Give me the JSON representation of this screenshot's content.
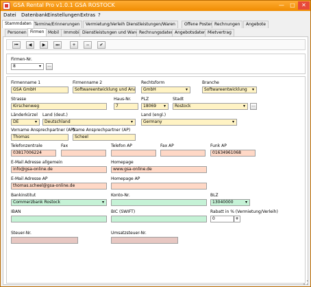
{
  "window": {
    "title": "GSA Rental Pro v1.0.1  GSA ROSTOCK",
    "min": "—",
    "max": "□",
    "close": "✕"
  },
  "menu": [
    "Datei",
    "Datenbank",
    "Einstellungen",
    "Extras",
    "?"
  ],
  "tabs_main": [
    "Stammdaten",
    "Termine/Erinnerungen",
    "Vermietung/Verleih Dienstleistungen/Waren",
    "Offene Posten",
    "Rechnungen",
    "Angebote"
  ],
  "tabs_sub": [
    "Personen",
    "Firmen",
    "Mobil",
    "Immobil",
    "Dienstleistungen und Waren",
    "Rechnungsdaten",
    "Angebotsdaten",
    "Mietvertrag"
  ],
  "toolbar": [
    "⏮",
    "◀",
    "▶",
    "⏭",
    "+",
    "−",
    "✔"
  ],
  "firmen_nr": {
    "label": "Firmen-Nr.",
    "value": "8"
  },
  "f": {
    "firmenname1": {
      "label": "Firmenname 1",
      "value": "GSA GmbH"
    },
    "firmenname2": {
      "label": "Firmenname 2",
      "value": "Softwareentwicklung und Analytik"
    },
    "rechtsform": {
      "label": "Rechtsform",
      "value": "GmbH"
    },
    "branche": {
      "label": "Branche",
      "value": "Softwareentwicklung"
    },
    "strasse": {
      "label": "Strasse",
      "value": "Kirschenweg"
    },
    "hausnr": {
      "label": "Haus-Nr.",
      "value": "7"
    },
    "plz": {
      "label": "PLZ",
      "value": "18069"
    },
    "stadt": {
      "label": "Stadt",
      "value": "Rostock"
    },
    "laenderkuerzel": {
      "label": "Länderkürzel",
      "value": "DE"
    },
    "land_deut": {
      "label": "Land (deut.)",
      "value": "Deutschland"
    },
    "land_engl": {
      "label": "Land (engl.)",
      "value": "Germany"
    },
    "vorname_ap": {
      "label": "Vorname Ansprechpartner (AP)",
      "value": "Thomas"
    },
    "name_ap": {
      "label": "Name Ansprechpartner (AP)",
      "value": "Scheel"
    },
    "telefonzentrale": {
      "label": "Telefonzentrale",
      "value": "03817006224"
    },
    "fax": {
      "label": "Fax",
      "value": ""
    },
    "telefon_ap": {
      "label": "Telefon AP",
      "value": ""
    },
    "fax_ap": {
      "label": "Fax AP",
      "value": ""
    },
    "funk_ap": {
      "label": "Funk AP",
      "value": "01634961068"
    },
    "email": {
      "label": "E-Mail Adresse allgemein",
      "value": "info@gsa-online.de"
    },
    "homepage": {
      "label": "Homepage",
      "value": "www.gsa-online.de"
    },
    "email_ap": {
      "label": "E-Mail Adresse AP",
      "value": "thomas.scheel@gsa-online.de"
    },
    "homepage_ap": {
      "label": "Homepage AP",
      "value": ""
    },
    "bankinstitut": {
      "label": "Bankinstitut",
      "value": "Commerzbank Rostock"
    },
    "kontonr": {
      "label": "Konto-Nr.",
      "value": ""
    },
    "blz": {
      "label": "BLZ",
      "value": "13040000"
    },
    "iban": {
      "label": "IBAN",
      "value": ""
    },
    "bic": {
      "label": "BIC (SWIFT)",
      "value": ""
    },
    "rabatt": {
      "label": "Rabatt in % (Vermietung/Verleih)",
      "value": "0"
    },
    "steuernr": {
      "label": "Steuer-Nr.",
      "value": ""
    },
    "ustnr": {
      "label": "Umsatzsteuer-Nr.",
      "value": ""
    }
  },
  "colors": {
    "titlebar": "#f08c00",
    "yellow_field": "#fff3c4",
    "pink_field": "#ffd8c6",
    "green_field": "#c5f2d6",
    "rose_field": "#e7c7c2"
  }
}
